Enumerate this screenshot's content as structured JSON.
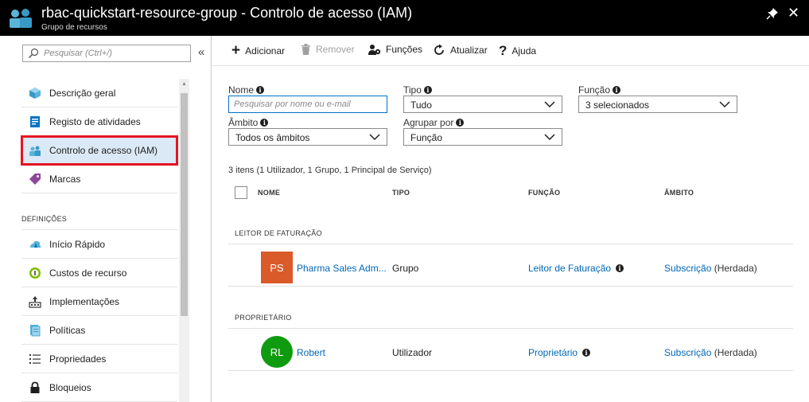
{
  "titlebar": {
    "title": "rbac-quickstart-resource-group - Controlo de acesso (IAM)",
    "subtitle": "Grupo de recursos",
    "close_glyph": "✕"
  },
  "sidebar": {
    "search_placeholder": "Pesquisar (Ctrl+/)",
    "collapse_glyph": "«",
    "items": [
      {
        "label": "Descrição geral",
        "icon": "overview-icon"
      },
      {
        "label": "Registo de atividades",
        "icon": "activity-log-icon"
      },
      {
        "label": "Controlo de acesso (IAM)",
        "icon": "iam-icon",
        "active": true
      },
      {
        "label": "Marcas",
        "icon": "tag-icon"
      }
    ],
    "section_label": "DEFINIÇÕES",
    "settings_items": [
      {
        "label": "Início Rápido",
        "icon": "quickstart-icon"
      },
      {
        "label": "Custos de recurso",
        "icon": "cost-icon"
      },
      {
        "label": "Implementações",
        "icon": "deployments-icon"
      },
      {
        "label": "Políticas",
        "icon": "policies-icon"
      },
      {
        "label": "Propriedades",
        "icon": "properties-icon"
      },
      {
        "label": "Bloqueios",
        "icon": "lock-icon"
      }
    ]
  },
  "toolbar": {
    "add_label": "Adicionar",
    "remove_label": "Remover",
    "roles_label": "Funções",
    "refresh_label": "Atualizar",
    "help_label": "Ajuda"
  },
  "filters": {
    "name_label": "Nome",
    "name_placeholder": "Pesquisar por nome ou e-mail",
    "type_label": "Tipo",
    "type_value": "Tudo",
    "role_label": "Função",
    "role_value": "3 selecionados",
    "scope_label": "Âmbito",
    "scope_value": "Todos os âmbitos",
    "group_label": "Agrupar por",
    "group_value": "Função"
  },
  "summary": "3 itens (1 Utilizador, 1 Grupo, 1 Principal de Serviço)",
  "columns": {
    "name": "NOME",
    "type": "TIPO",
    "role": "FUNÇÃO",
    "scope": "ÂMBITO"
  },
  "groups": [
    {
      "header": "LEITOR DE FATURAÇÃO",
      "row": {
        "initials": "PS",
        "avatar_color": "#da5a2a",
        "name": "Pharma Sales Adm...",
        "type": "Grupo",
        "role": "Leitor de Faturação",
        "scope_link": "Subscrição",
        "scope_note": "(Herdada)"
      }
    },
    {
      "header": "PROPRIETÁRIO",
      "row": {
        "initials": "RL",
        "avatar_color": "#0f9b0f",
        "name": "Robert",
        "type": "Utilizador",
        "role": "Proprietário",
        "scope_link": "Subscrição",
        "scope_note": "(Herdada)"
      }
    }
  ],
  "colors": {
    "link": "#0067b8",
    "active_outline": "#e5141f",
    "active_bg": "#dbe8f5"
  }
}
